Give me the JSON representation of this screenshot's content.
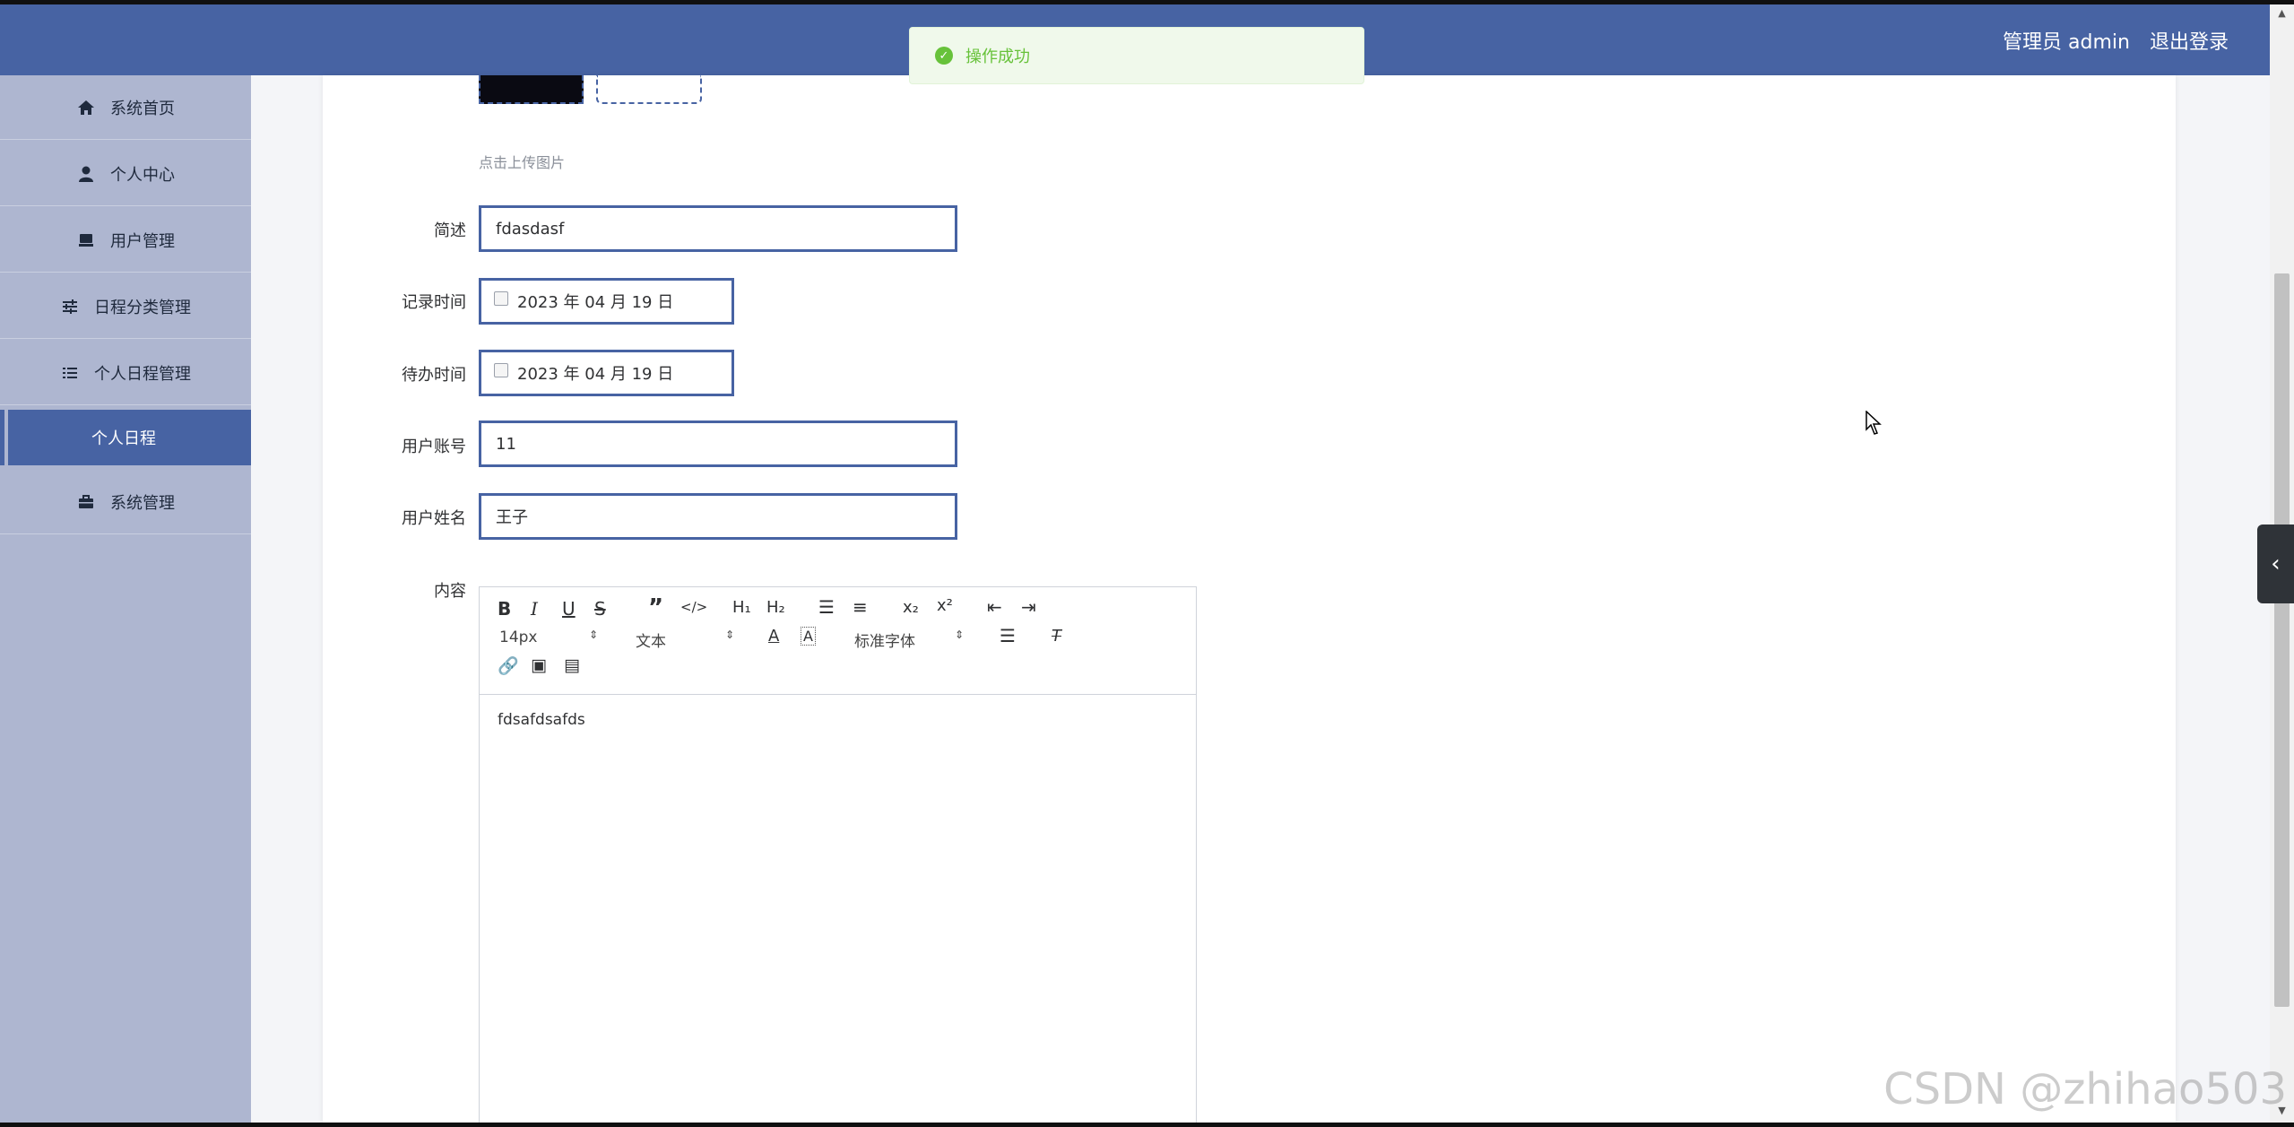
{
  "header": {
    "user_label": "管理员 admin",
    "logout_label": "退出登录"
  },
  "sidebar": {
    "items": [
      {
        "label": "系统首页",
        "icon": "home-icon"
      },
      {
        "label": "个人中心",
        "icon": "user-icon"
      },
      {
        "label": "用户管理",
        "icon": "monitor-icon"
      },
      {
        "label": "日程分类管理",
        "icon": "sliders-icon"
      },
      {
        "label": "个人日程管理",
        "icon": "list-icon"
      },
      {
        "label": "系统管理",
        "icon": "briefcase-icon"
      }
    ],
    "active_sub": "个人日程"
  },
  "toast": {
    "message": "操作成功",
    "color": "#67c23a"
  },
  "form": {
    "upload_tip": "点击上传图片",
    "summary": {
      "label": "简述",
      "value": "fdasdasf"
    },
    "record_time": {
      "label": "记录时间",
      "value": "2023 年 04 月 19 日"
    },
    "todo_time": {
      "label": "待办时间",
      "value": "2023 年 04 月 19 日"
    },
    "account": {
      "label": "用户账号",
      "value": "11"
    },
    "name": {
      "label": "用户姓名",
      "value": "王子"
    },
    "content": {
      "label": "内容",
      "font_size": "14px",
      "text_type": "文本",
      "font_family": "标准字体",
      "body": "fdsafdsafds"
    }
  },
  "watermark": "CSDN @zhihao503",
  "colors": {
    "primary": "#4763a3",
    "sidebar_bg": "#aeb6d0",
    "success": "#67c23a"
  }
}
